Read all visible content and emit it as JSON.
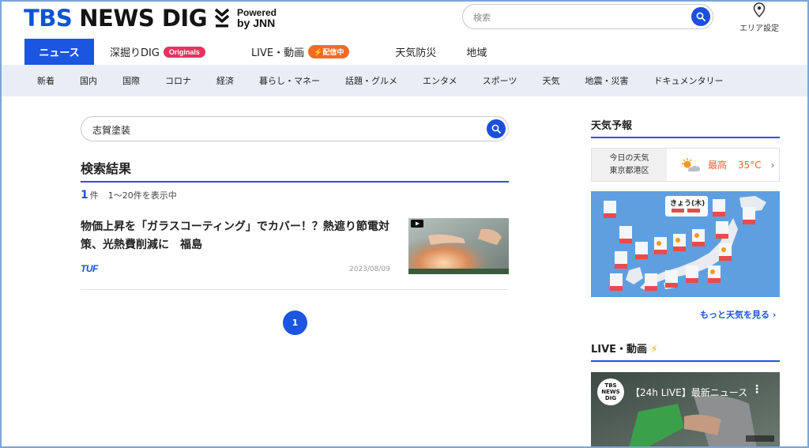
{
  "header": {
    "logo": {
      "brand_blue": "TBS",
      "brand_dark": "NEWS DIG",
      "powered_line1": "Powered",
      "powered_line2": "by JNN"
    },
    "search": {
      "placeholder": "検索"
    },
    "area_label": "エリア設定",
    "tabs": [
      {
        "label": "ニュース",
        "active": true
      },
      {
        "label": "深掘りDIG",
        "badge": "Originals"
      },
      {
        "label": "LIVE・動画",
        "badge": "配信中"
      },
      {
        "label": "天気防災"
      },
      {
        "label": "地域"
      }
    ]
  },
  "subnav": {
    "items": [
      "新着",
      "国内",
      "国際",
      "コロナ",
      "経済",
      "暮らし・マネー",
      "話題・グルメ",
      "エンタメ",
      "スポーツ",
      "天気",
      "地震・災害",
      "ドキュメンタリー"
    ]
  },
  "main": {
    "search_value": "志賀塗装",
    "results_title": "検索結果",
    "results_count": {
      "num": "1",
      "unit": "件",
      "text": "1〜20件を表示中"
    },
    "article": {
      "title": "物価上昇を「ガラスコーティング」でカバー！？熱遮り節電対策、光熱費削減に　福島",
      "source": "TUF",
      "date": "2023/08/09"
    },
    "pager": {
      "current": "1"
    }
  },
  "sidebar": {
    "weather_title": "天気予報",
    "weather_today": {
      "line1": "今日の天気",
      "line2": "東京都港区",
      "label": "最高",
      "temp": "35°C"
    },
    "weather_map_label": "きょう(木)",
    "more_weather": "もっと天気を見る ›",
    "live_title": "LIVE・動画",
    "live_video": {
      "title": "【24h LIVE】最新ニュース",
      "channel": "TBS NEWS DIG"
    }
  },
  "colors": {
    "accent": "#1b55e0",
    "pink": "#e8315f",
    "orange": "#f26b23",
    "subnav_bg": "#e9eef6"
  }
}
